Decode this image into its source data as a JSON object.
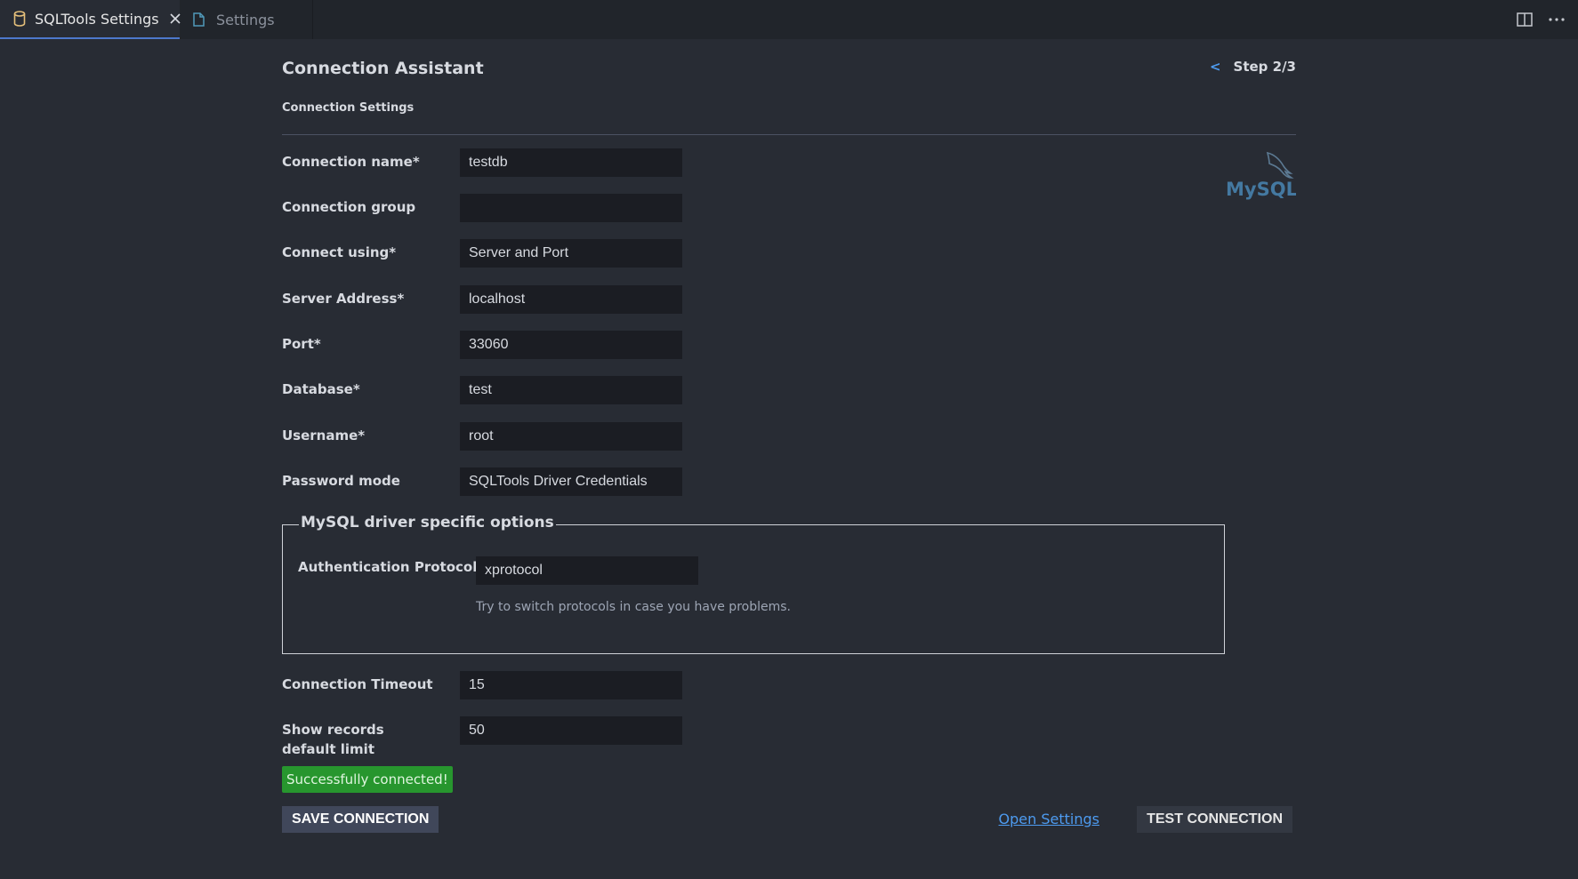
{
  "tabs": [
    {
      "label": "SQLTools Settings",
      "active": true
    },
    {
      "label": "Settings",
      "active": false
    }
  ],
  "header": {
    "title": "Connection Assistant",
    "step_back": "<",
    "step": "Step 2/3",
    "subtitle": "Connection Settings"
  },
  "logo": {
    "text": "MySQL",
    "icon": "mysql-dolphin-logo"
  },
  "fields": [
    {
      "label": "Connection name*",
      "value": "testdb"
    },
    {
      "label": "Connection group",
      "value": ""
    },
    {
      "label": "Connect using*",
      "value": "Server and Port"
    },
    {
      "label": "Server Address*",
      "value": "localhost"
    },
    {
      "label": "Port*",
      "value": "33060"
    },
    {
      "label": "Database*",
      "value": "test"
    },
    {
      "label": "Username*",
      "value": "root"
    },
    {
      "label": "Password mode",
      "value": "SQLTools Driver Credentials"
    }
  ],
  "driver_options": {
    "legend": "MySQL driver specific options",
    "auth_label": "Authentication Protocol",
    "auth_value": "xprotocol",
    "auth_hint": "Try to switch protocols in case you have problems."
  },
  "extra_fields": [
    {
      "label": "Connection Timeout",
      "value": "15"
    },
    {
      "label": "Show records default limit",
      "value": "50"
    }
  ],
  "status": {
    "text": "Successfully connected!",
    "color": "#27962e"
  },
  "actions": {
    "save_label": "SAVE CONNECTION",
    "open_settings_label": "Open Settings",
    "test_label": "TEST CONNECTION"
  },
  "colors": {
    "background": "#282c34",
    "tabbar": "#21252b",
    "accent": "#4d9bf0",
    "mysql_blue": "#4479a1",
    "mysql_orange": "#e48e00"
  }
}
